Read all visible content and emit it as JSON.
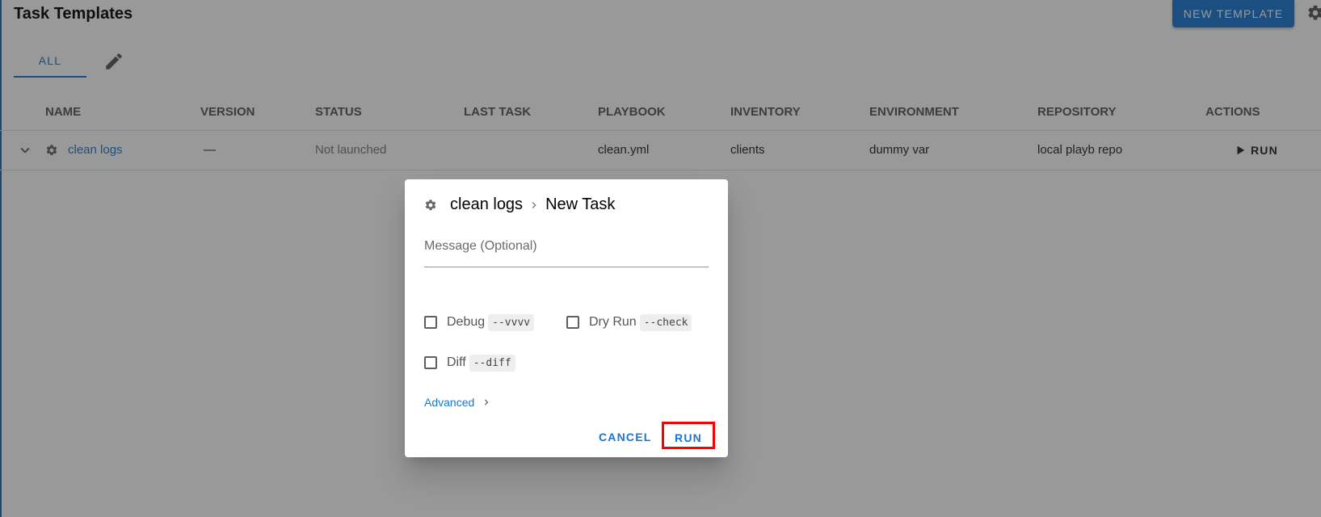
{
  "header": {
    "title": "Task Templates",
    "new_template_label": "NEW TEMPLATE",
    "settings_icon": "gear-icon"
  },
  "tabs": [
    {
      "label": "ALL",
      "active": true
    },
    {
      "icon": "pencil-icon"
    }
  ],
  "table": {
    "columns": [
      "NAME",
      "VERSION",
      "STATUS",
      "LAST TASK",
      "PLAYBOOK",
      "INVENTORY",
      "ENVIRONMENT",
      "REPOSITORY",
      "ACTIONS"
    ],
    "rows": [
      {
        "name": "clean logs",
        "version": "—",
        "status": "Not launched",
        "last_task": "",
        "playbook": "clean.yml",
        "inventory": "clients",
        "environment": "dummy var",
        "repository": "local playb repo",
        "action": "RUN"
      }
    ]
  },
  "dialog": {
    "template_name": "clean logs",
    "title": "New Task",
    "message_placeholder": "Message (Optional)",
    "options": [
      {
        "label": "Debug",
        "flag": "--vvvv",
        "checked": false
      },
      {
        "label": "Dry Run",
        "flag": "--check",
        "checked": false
      },
      {
        "label": "Diff",
        "flag": "--diff",
        "checked": false
      }
    ],
    "advanced_label": "Advanced",
    "cancel_label": "CANCEL",
    "run_label": "RUN"
  },
  "colors": {
    "primary": "#1976d2",
    "highlight": "#ff0000"
  }
}
